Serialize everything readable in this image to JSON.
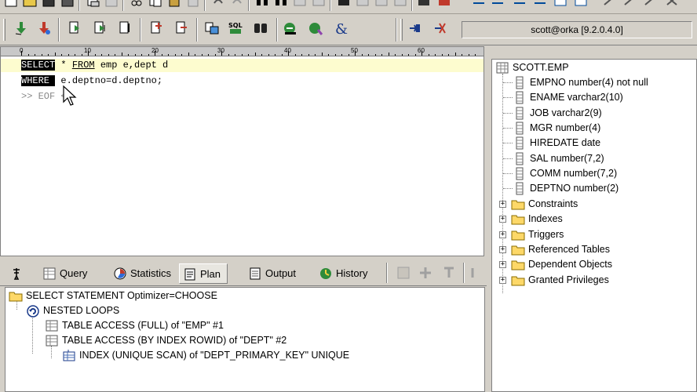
{
  "toolbar": {
    "connection_label": "scott@orka [9.2.0.4.0]"
  },
  "editor": {
    "ruler_marks": [
      "0",
      "10",
      "20",
      "30",
      "40",
      "50",
      "60"
    ],
    "lines": [
      {
        "kw": "SELECT",
        "pre": " * ",
        "ul": "FROM",
        "post": " emp e,dept d"
      },
      {
        "kw": "WHERE ",
        "pre": " e.deptno=d.deptno;",
        "ul": "",
        "post": ""
      }
    ],
    "eof": ">> EOF <<"
  },
  "tabs": [
    {
      "label": "",
      "icon": "pin-icon"
    },
    {
      "label": "Query",
      "icon": "table-icon"
    },
    {
      "label": "Statistics",
      "icon": "statistics-icon"
    },
    {
      "label": "Plan",
      "icon": "plan-icon"
    },
    {
      "label": "Output",
      "icon": "output-icon"
    },
    {
      "label": "History",
      "icon": "history-icon"
    }
  ],
  "plan": {
    "rows": [
      {
        "text": "SELECT STATEMENT Optimizer=CHOOSE",
        "icon": "folder-icon",
        "indent": 0
      },
      {
        "text": "NESTED LOOPS",
        "icon": "loop-icon",
        "indent": 1
      },
      {
        "text": "TABLE ACCESS (FULL) of \"EMP\" #1",
        "icon": "table-icon",
        "indent": 2
      },
      {
        "text": "TABLE ACCESS (BY INDEX ROWID) of \"DEPT\" #2",
        "icon": "table-icon",
        "indent": 2
      },
      {
        "text": "INDEX (UNIQUE SCAN) of \"DEPT_PRIMARY_KEY\" UNIQUE",
        "icon": "index-icon",
        "indent": 3
      }
    ]
  },
  "schema_tree": {
    "root": "SCOTT.EMP",
    "columns": [
      "EMPNO  number(4)  not null",
      "ENAME  varchar2(10)",
      "JOB  varchar2(9)",
      "MGR  number(4)",
      "HIREDATE  date",
      "SAL  number(7,2)",
      "COMM  number(7,2)",
      "DEPTNO  number(2)"
    ],
    "folders": [
      "Constraints",
      "Indexes",
      "Triggers",
      "Referenced Tables",
      "Dependent Objects",
      "Granted Privileges"
    ]
  }
}
